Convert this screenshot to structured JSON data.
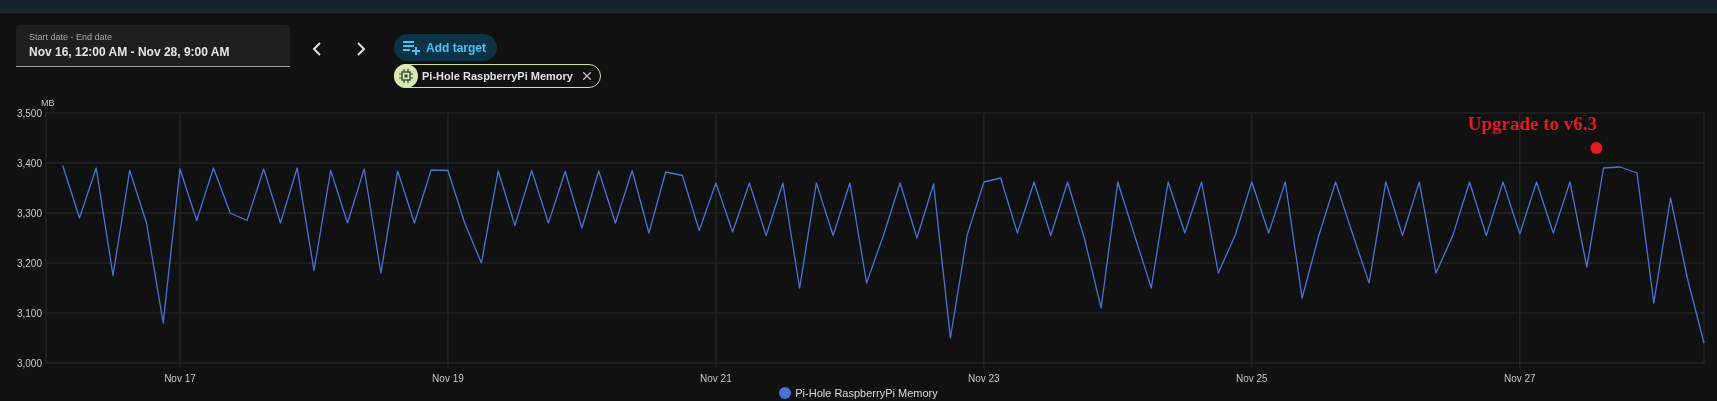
{
  "date_range": {
    "label": "Start date - End date",
    "value": "Nov 16, 12:00 AM - Nov 28, 9:00 AM"
  },
  "add_target_button": {
    "label": "Add target"
  },
  "targets": [
    {
      "label": "Pi-Hole RaspberryPi Memory"
    }
  ],
  "chart": {
    "chart_data": {
      "type": "line",
      "ylabel": "MB",
      "categories": [
        null,
        null,
        null,
        null,
        null,
        null,
        null,
        "Nov 17",
        null,
        null,
        null,
        null,
        null,
        null,
        null,
        null,
        null,
        null,
        null,
        null,
        null,
        null,
        null,
        "Nov 19",
        null,
        null,
        null,
        null,
        null,
        null,
        null,
        null,
        null,
        null,
        null,
        null,
        null,
        null,
        null,
        "Nov 21",
        null,
        null,
        null,
        null,
        null,
        null,
        null,
        null,
        null,
        null,
        null,
        null,
        null,
        null,
        null,
        "Nov 23",
        null,
        null,
        null,
        null,
        null,
        null,
        null,
        null,
        null,
        null,
        null,
        null,
        null,
        null,
        null,
        "Nov 25",
        null,
        null,
        null,
        null,
        null,
        null,
        null,
        null,
        null,
        null,
        null,
        null,
        null,
        null,
        null,
        "Nov 27",
        null,
        null,
        null,
        null,
        null,
        null,
        null,
        null,
        null,
        null,
        null
      ],
      "series": [
        {
          "name": "Pi-Hole RaspberryPi Memory",
          "color": "#4a72d6",
          "values": [
            3395,
            3290,
            3390,
            3175,
            3385,
            3280,
            3080,
            3388,
            3285,
            3390,
            3300,
            3285,
            3388,
            3280,
            3390,
            3185,
            3385,
            3280,
            3388,
            3180,
            3384,
            3280,
            3386,
            3385,
            3280,
            3200,
            3384,
            3275,
            3385,
            3280,
            3383,
            3270,
            3384,
            3280,
            3385,
            3260,
            3382,
            3375,
            3265,
            3360,
            3262,
            3360,
            3255,
            3360,
            3150,
            3360,
            3255,
            3360,
            3160,
            3255,
            3360,
            3250,
            3358,
            3050,
            3255,
            3362,
            3370,
            3260,
            3362,
            3255,
            3362,
            3250,
            3110,
            3362,
            3255,
            3150,
            3362,
            3260,
            3362,
            3180,
            3255,
            3362,
            3260,
            3362,
            3130,
            3255,
            3362,
            3260,
            3160,
            3362,
            3255,
            3362,
            3180,
            3255,
            3362,
            3255,
            3362,
            3258,
            3362,
            3260,
            3362,
            3192,
            3390,
            3392,
            3380,
            3120,
            3330,
            3170,
            3040
          ]
        }
      ],
      "grid": true,
      "ylim": [
        3000,
        3500
      ],
      "yticks": [
        {
          "value": 3000,
          "label": "3,000"
        },
        {
          "value": 3100,
          "label": "3,100"
        },
        {
          "value": 3200,
          "label": "3,200"
        },
        {
          "value": 3300,
          "label": "3,300"
        },
        {
          "value": 3400,
          "label": "3,400"
        },
        {
          "value": 3500,
          "label": "3,500"
        }
      ],
      "annotations": [
        "Upgrade to v6.3"
      ]
    }
  }
}
